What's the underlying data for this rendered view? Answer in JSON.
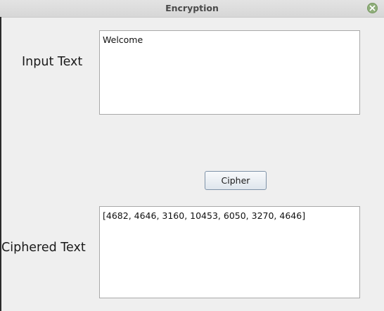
{
  "window": {
    "title": "Encryption",
    "close_icon": "close-icon"
  },
  "form": {
    "input_label": "Input Text",
    "input_value": "Welcome",
    "cipher_button_label": "Cipher",
    "output_label": "Ciphered Text",
    "output_value": "[4682, 4646, 3160, 10453, 6050, 3270, 4646]"
  },
  "colors": {
    "window_background": "#efefef",
    "titlebar": "#dcdcdc",
    "close_button": "#8fae7a",
    "button_border": "#7f93a8"
  }
}
